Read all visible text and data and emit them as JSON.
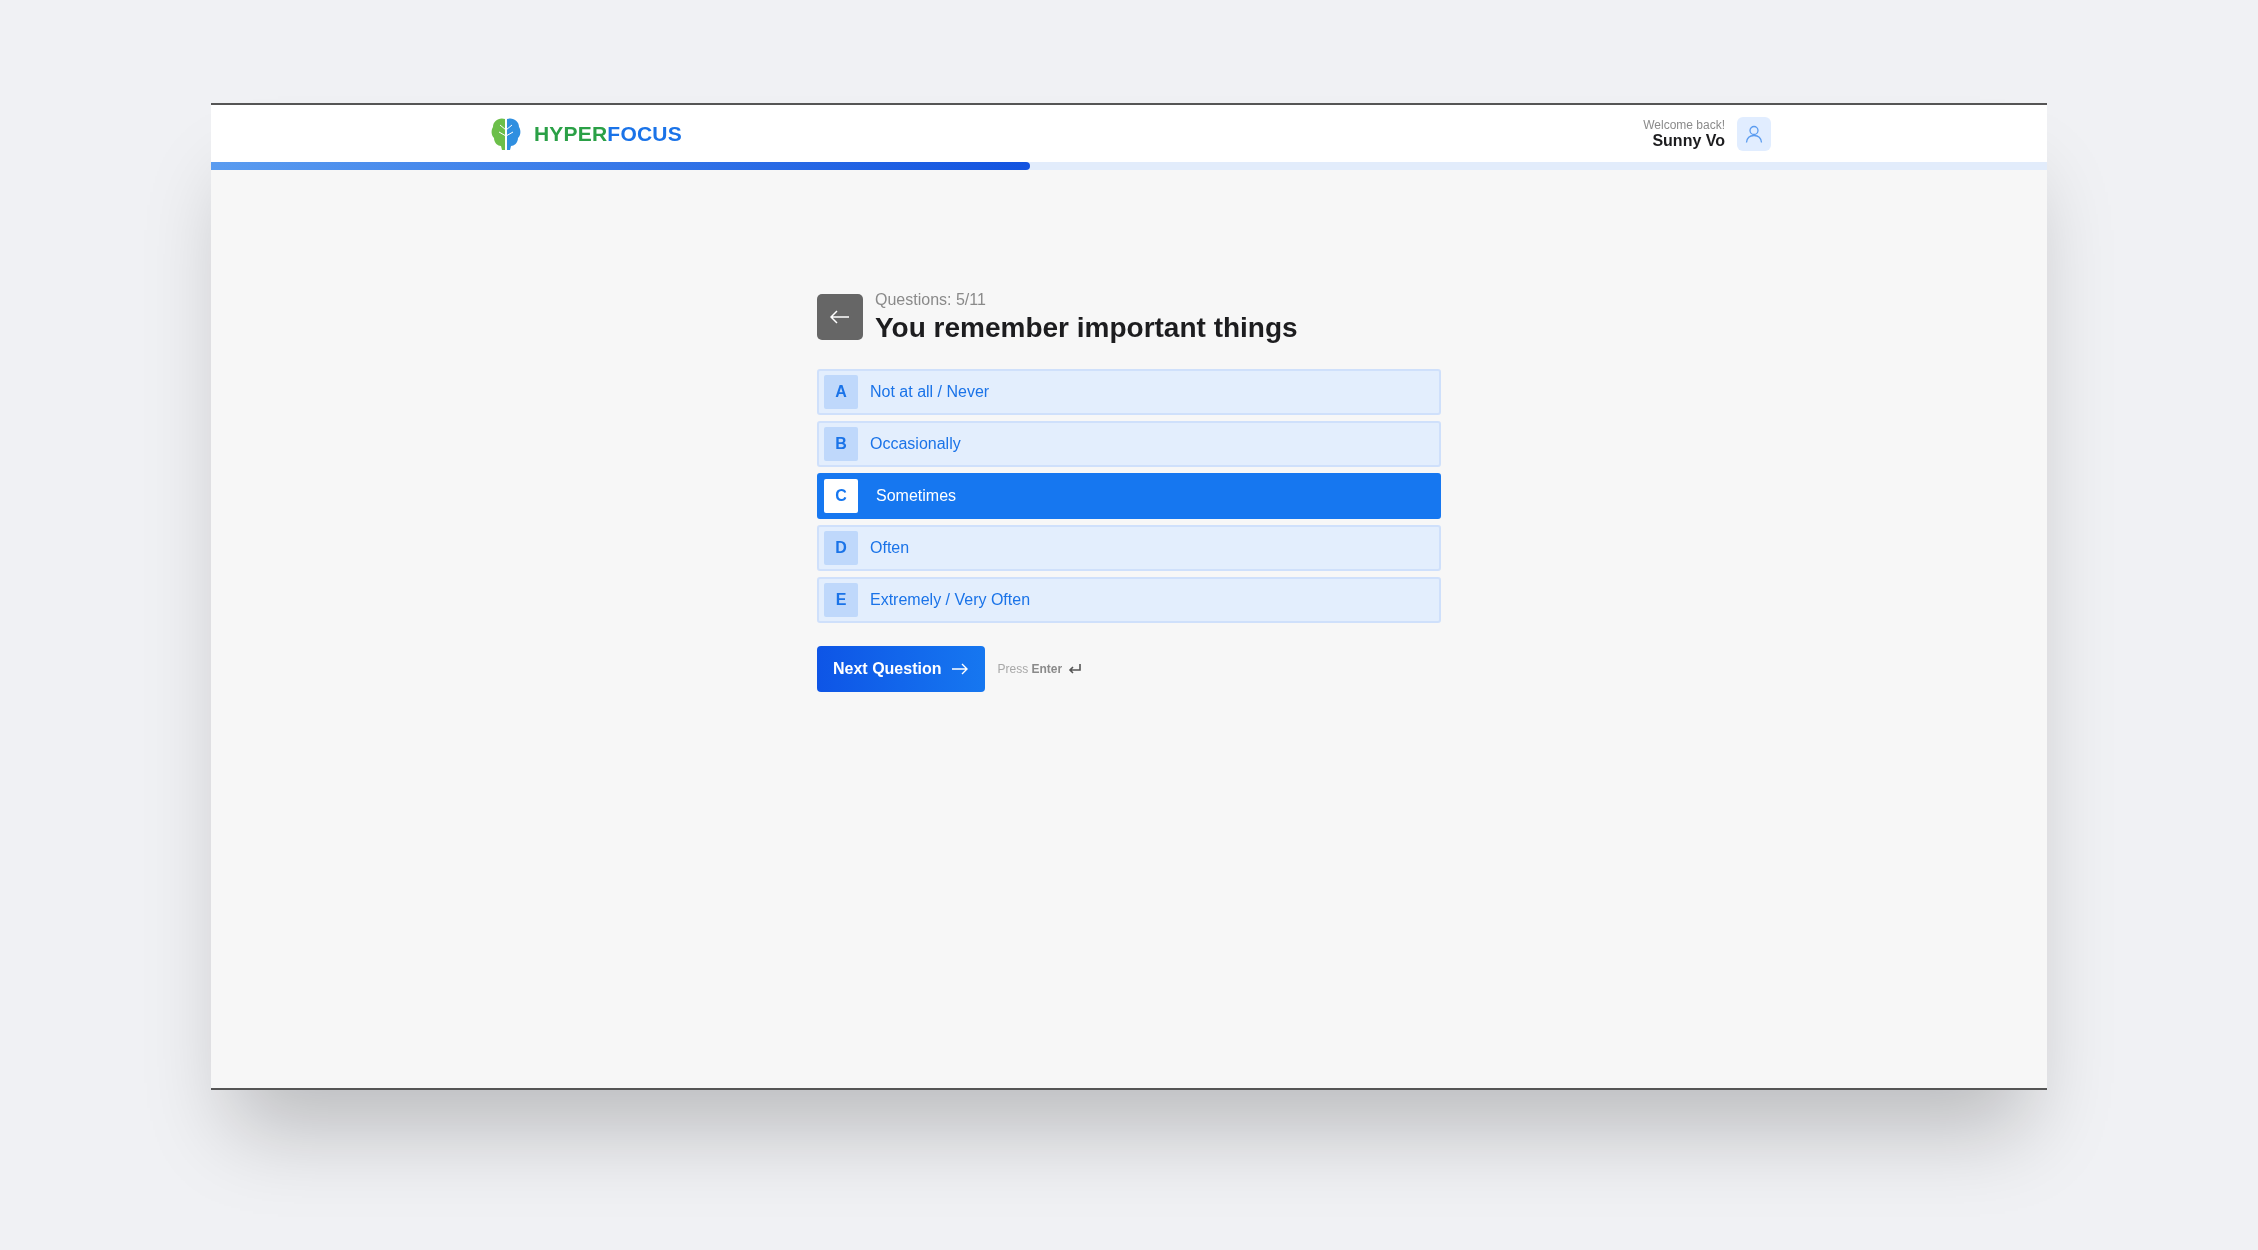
{
  "header": {
    "brand": [
      {
        "text": "HYPER",
        "color": "#2aa046"
      },
      {
        "text": "FOCUS",
        "color": "#1a73e8"
      }
    ],
    "welcome": "Welcome back!",
    "user_name": "Sunny Vo"
  },
  "progress": {
    "level": 0.446
  },
  "question": {
    "counter": "Questions: 5/11",
    "title": "You remember important things"
  },
  "options": [
    {
      "letter": "A",
      "label": "Not at all / Never",
      "selected": false
    },
    {
      "letter": "B",
      "label": "Occasionally",
      "selected": false
    },
    {
      "letter": "C",
      "label": "Sometimes",
      "selected": true
    },
    {
      "letter": "D",
      "label": "Often",
      "selected": false
    },
    {
      "letter": "E",
      "label": "Extremely / Very Often",
      "selected": false
    }
  ],
  "next_button": "Next Question",
  "hint": "Press **Enter**"
}
